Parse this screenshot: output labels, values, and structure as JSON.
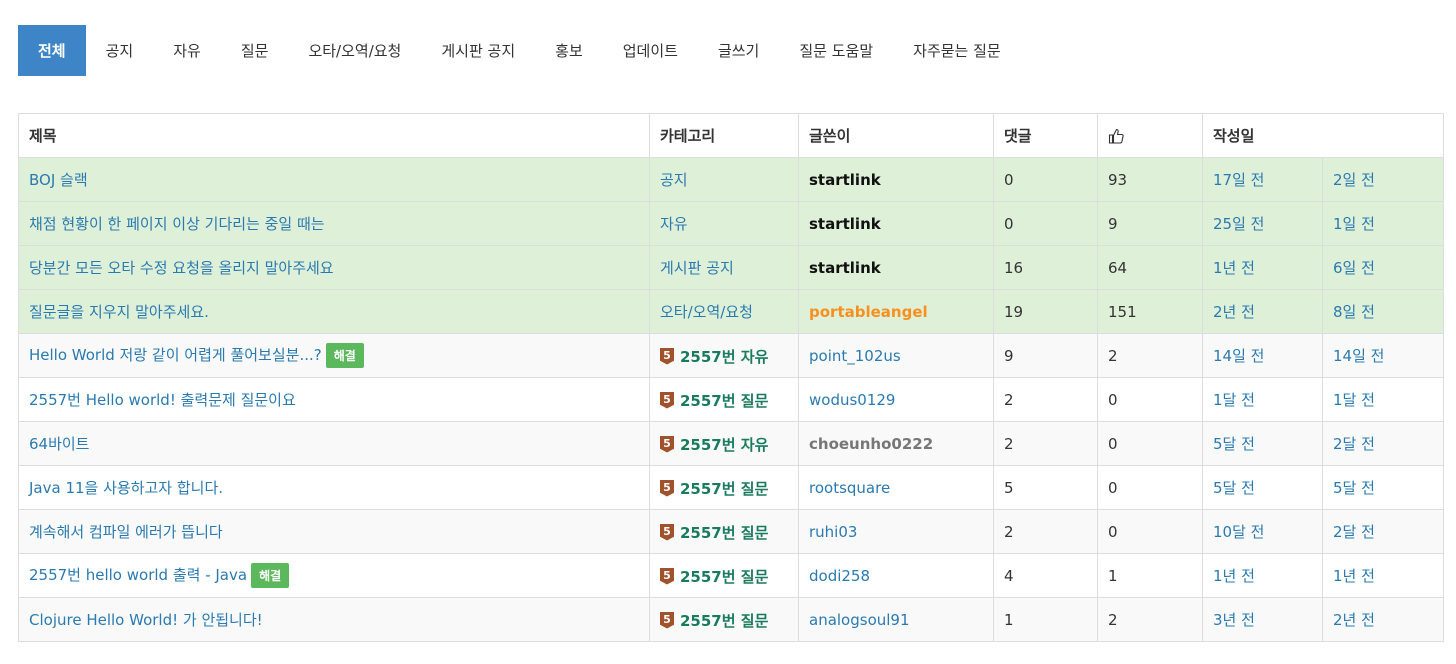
{
  "tabs": [
    {
      "label": "전체",
      "active": true
    },
    {
      "label": "공지"
    },
    {
      "label": "자유"
    },
    {
      "label": "질문"
    },
    {
      "label": "오타/오역/요청"
    },
    {
      "label": "게시판 공지"
    },
    {
      "label": "홍보"
    },
    {
      "label": "업데이트"
    },
    {
      "label": "글쓰기"
    },
    {
      "label": "질문 도움말"
    },
    {
      "label": "자주묻는 질문"
    }
  ],
  "table": {
    "headers": {
      "title": "제목",
      "category": "카테고리",
      "author": "글쓴이",
      "comments": "댓글",
      "likes_icon": "thumbs-up-icon",
      "date": "작성일"
    },
    "rows": [
      {
        "type": "notice",
        "title": "BOJ 슬랙",
        "category": "공지",
        "author": "startlink",
        "author_style": "black",
        "comments": "0",
        "likes": "93",
        "created": "17일 전",
        "updated": "2일 전"
      },
      {
        "type": "notice",
        "title": "채점 현황이 한 페이지 이상 기다리는 중일 때는",
        "category": "자유",
        "author": "startlink",
        "author_style": "black",
        "comments": "0",
        "likes": "9",
        "created": "25일 전",
        "updated": "1일 전"
      },
      {
        "type": "notice",
        "title": "당분간 모든 오타 수정 요청을 올리지 말아주세요",
        "category": "게시판 공지",
        "author": "startlink",
        "author_style": "black",
        "comments": "16",
        "likes": "64",
        "created": "1년 전",
        "updated": "6일 전"
      },
      {
        "type": "notice",
        "title": "질문글을 지우지 말아주세요.",
        "category": "오타/오역/요청",
        "author": "portableangel",
        "author_style": "orange",
        "comments": "19",
        "likes": "151",
        "created": "2년 전",
        "updated": "8일 전"
      },
      {
        "type": "post",
        "title": "Hello World 저랑 같이 어렵게 풀어보실분...?",
        "solved": "해결",
        "category": "2557번 자유",
        "author": "point_102us",
        "author_style": "blue",
        "comments": "9",
        "likes": "2",
        "created": "14일 전",
        "updated": "14일 전"
      },
      {
        "type": "post",
        "title": "2557번 Hello world! 출력문제 질문이요",
        "category": "2557번 질문",
        "author": "wodus0129",
        "author_style": "blue",
        "comments": "2",
        "likes": "0",
        "created": "1달 전",
        "updated": "1달 전"
      },
      {
        "type": "post",
        "title": "64바이트",
        "category": "2557번 자유",
        "author": "choeunho0222",
        "author_style": "gray",
        "comments": "2",
        "likes": "0",
        "created": "5달 전",
        "updated": "2달 전"
      },
      {
        "type": "post",
        "title": "Java 11을 사용하고자 합니다.",
        "category": "2557번 질문",
        "author": "rootsquare",
        "author_style": "blue",
        "comments": "5",
        "likes": "0",
        "created": "5달 전",
        "updated": "5달 전"
      },
      {
        "type": "post",
        "title": "계속해서 컴파일 에러가 뜹니다",
        "category": "2557번 질문",
        "author": "ruhi03",
        "author_style": "blue",
        "comments": "2",
        "likes": "0",
        "created": "10달 전",
        "updated": "2달 전"
      },
      {
        "type": "post",
        "title": "2557번 hello world 출력 - Java",
        "solved": "해결",
        "category": "2557번 질문",
        "author": "dodi258",
        "author_style": "blue",
        "comments": "4",
        "likes": "1",
        "created": "1년 전",
        "updated": "1년 전"
      },
      {
        "type": "post",
        "title": "Clojure Hello World! 가 안됩니다!",
        "category": "2557번 질문",
        "author": "analogsoul91",
        "author_style": "blue",
        "comments": "1",
        "likes": "2",
        "created": "3년 전",
        "updated": "2년 전"
      }
    ],
    "tier_badge": "5"
  }
}
